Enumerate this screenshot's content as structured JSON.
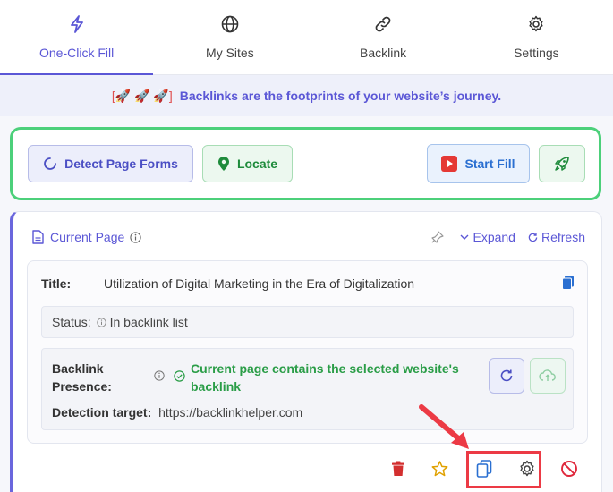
{
  "tabs": [
    {
      "label": "One-Click Fill",
      "icon": "bolt-icon",
      "active": true
    },
    {
      "label": "My Sites",
      "icon": "globe-icon"
    },
    {
      "label": "Backlink",
      "icon": "link-icon"
    },
    {
      "label": "Settings",
      "icon": "gear-icon"
    }
  ],
  "slogan": {
    "emoji": "[🚀 🚀 🚀]",
    "text": "Backlinks are the footprints of your website’s journey."
  },
  "actions": {
    "detect_label": "Detect Page Forms",
    "locate_label": "Locate",
    "start_label": "Start Fill"
  },
  "card": {
    "header": "Current Page",
    "expand_label": "Expand",
    "refresh_label": "Refresh",
    "title_label": "Title:",
    "title_value": "Utilization of Digital Marketing in the Era of Digitalization",
    "status_label": "Status:",
    "status_value": "In backlink list",
    "backlink_label": "Backlink Presence:",
    "backlink_value": "Current page contains the selected website's backlink",
    "target_label": "Detection target:",
    "target_value": "https://backlinkhelper.com"
  },
  "colors": {
    "accent": "#5b57d6",
    "success": "#2a9d47",
    "highlight": "#ec3a45"
  }
}
